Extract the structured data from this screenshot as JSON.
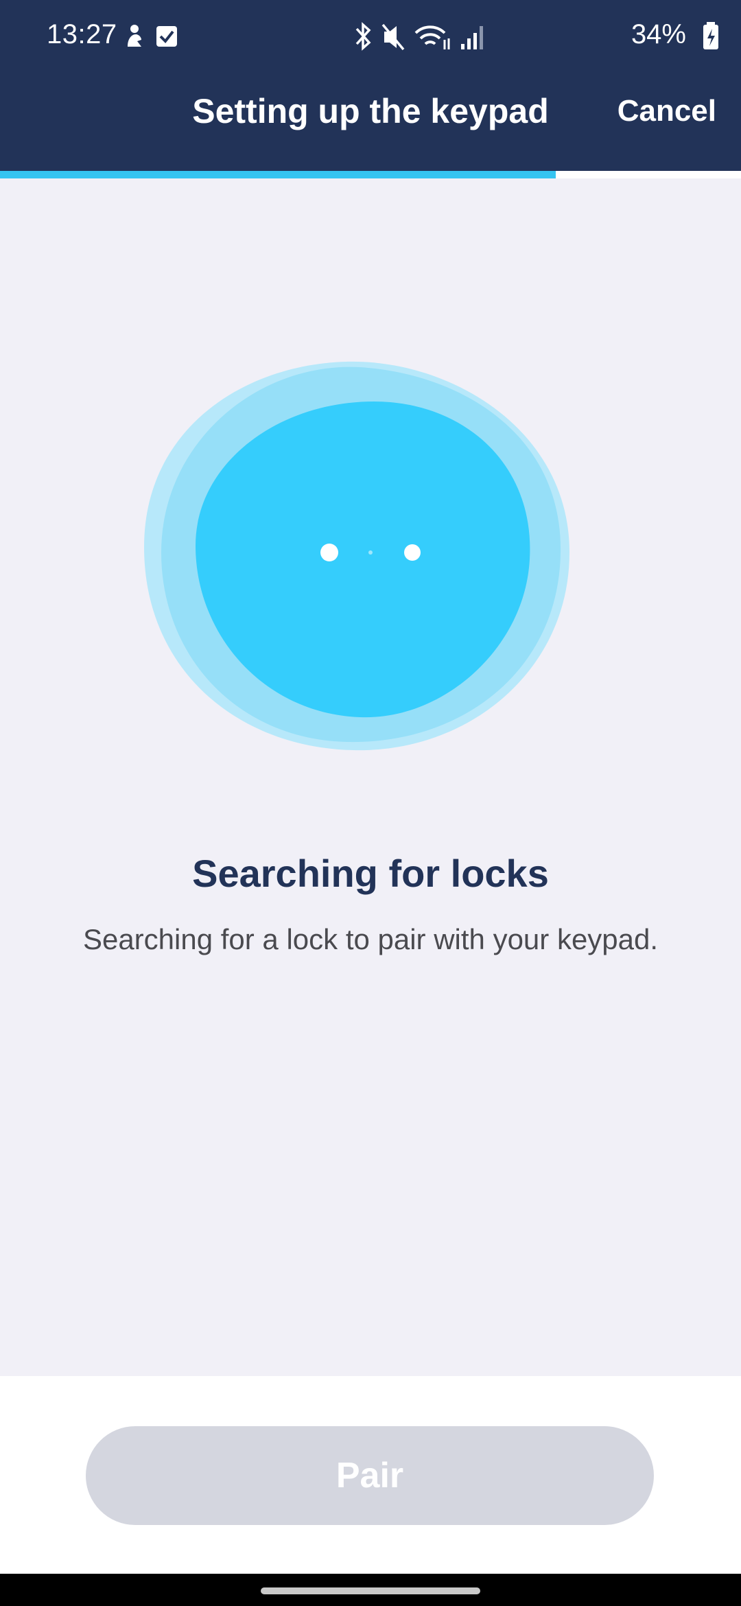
{
  "status_bar": {
    "time": "13:27",
    "battery": "34%",
    "icons": [
      "notification-person-icon",
      "checkbox-icon",
      "bluetooth-icon",
      "mute-icon",
      "wifi-icon",
      "signal-icon",
      "battery-charging-icon"
    ]
  },
  "header": {
    "title": "Setting up the keypad",
    "cancel_label": "Cancel"
  },
  "progress": {
    "fraction": 0.75
  },
  "main": {
    "heading": "Searching for locks",
    "description": "Searching for a lock to pair with your keypad."
  },
  "footer": {
    "pair_label": "Pair"
  },
  "colors": {
    "header_bg": "#223358",
    "accent": "#35c4f1",
    "background": "#f1f0f7",
    "disabled_button": "#d4d6df"
  }
}
